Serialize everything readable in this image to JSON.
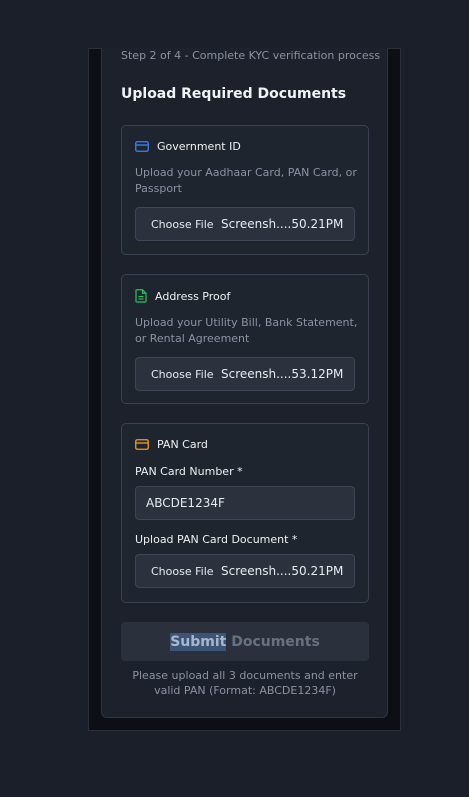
{
  "header": {
    "step_text": "Step 2 of 4 - Complete KYC verification process",
    "section_title": "Upload Required Documents"
  },
  "government_id": {
    "title": "Government ID",
    "icon": "credit-card-icon",
    "icon_color": "#3b82f6",
    "description": "Upload your Aadhaar Card, PAN Card, or Passport",
    "choose_label": "Choose File",
    "file_name": "Screensh....50.21PM"
  },
  "address_proof": {
    "title": "Address Proof",
    "icon": "document-icon",
    "icon_color": "#22c55e",
    "description": "Upload your Utility Bill, Bank Statement, or Rental Agreement",
    "choose_label": "Choose File",
    "file_name": "Screensh....53.12PM"
  },
  "pan_card": {
    "title": "PAN Card",
    "icon": "credit-card-icon",
    "icon_color": "#f59e0b",
    "number_label": "PAN Card Number *",
    "number_value": "ABCDE1234F",
    "upload_label": "Upload PAN Card Document *",
    "choose_label": "Choose File",
    "file_name": "Screensh....50.21PM"
  },
  "submit": {
    "highlighted": "Submit",
    "rest": " Documents"
  },
  "help_text": "Please upload all 3 documents and enter valid PAN (Format: ABCDE1234F)"
}
